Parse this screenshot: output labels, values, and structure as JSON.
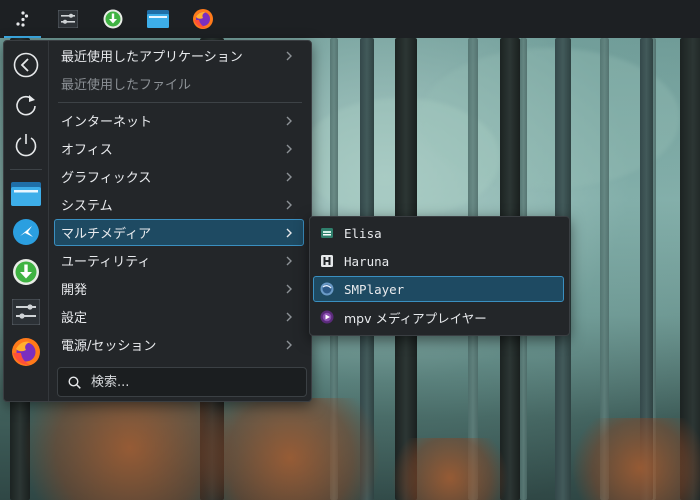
{
  "panel": {
    "items": [
      {
        "name": "application-launcher-icon"
      },
      {
        "name": "system-settings-icon"
      },
      {
        "name": "discover-icon"
      },
      {
        "name": "file-manager-icon"
      },
      {
        "name": "firefox-icon"
      }
    ]
  },
  "launcher": {
    "categories": [
      {
        "label": "最近使用したアプリケーション",
        "dim": false
      },
      {
        "label": "最近使用したファイル",
        "dim": true
      },
      {
        "label": "インターネット",
        "dim": false
      },
      {
        "label": "オフィス",
        "dim": false
      },
      {
        "label": "グラフィックス",
        "dim": false
      },
      {
        "label": "システム",
        "dim": false
      },
      {
        "label": "マルチメディア",
        "dim": false,
        "selected": true
      },
      {
        "label": "ユーティリティ",
        "dim": false
      },
      {
        "label": "開発",
        "dim": false
      },
      {
        "label": "設定",
        "dim": false
      },
      {
        "label": "電源/セッション",
        "dim": false
      }
    ],
    "search": {
      "placeholder": "検索..."
    }
  },
  "submenu": {
    "items": [
      {
        "label": "Elisa",
        "icon": "elisa-icon"
      },
      {
        "label": "Haruna",
        "icon": "haruna-icon"
      },
      {
        "label": "SMPlayer",
        "icon": "smplayer-icon",
        "selected": true
      },
      {
        "label": "mpv メディアプレイヤー",
        "icon": "mpv-icon"
      }
    ]
  },
  "colors": {
    "accent": "#3daee9",
    "selection_bg": "#1e4a62",
    "panel_bg": "#1d2023",
    "menu_bg": "#232629"
  }
}
